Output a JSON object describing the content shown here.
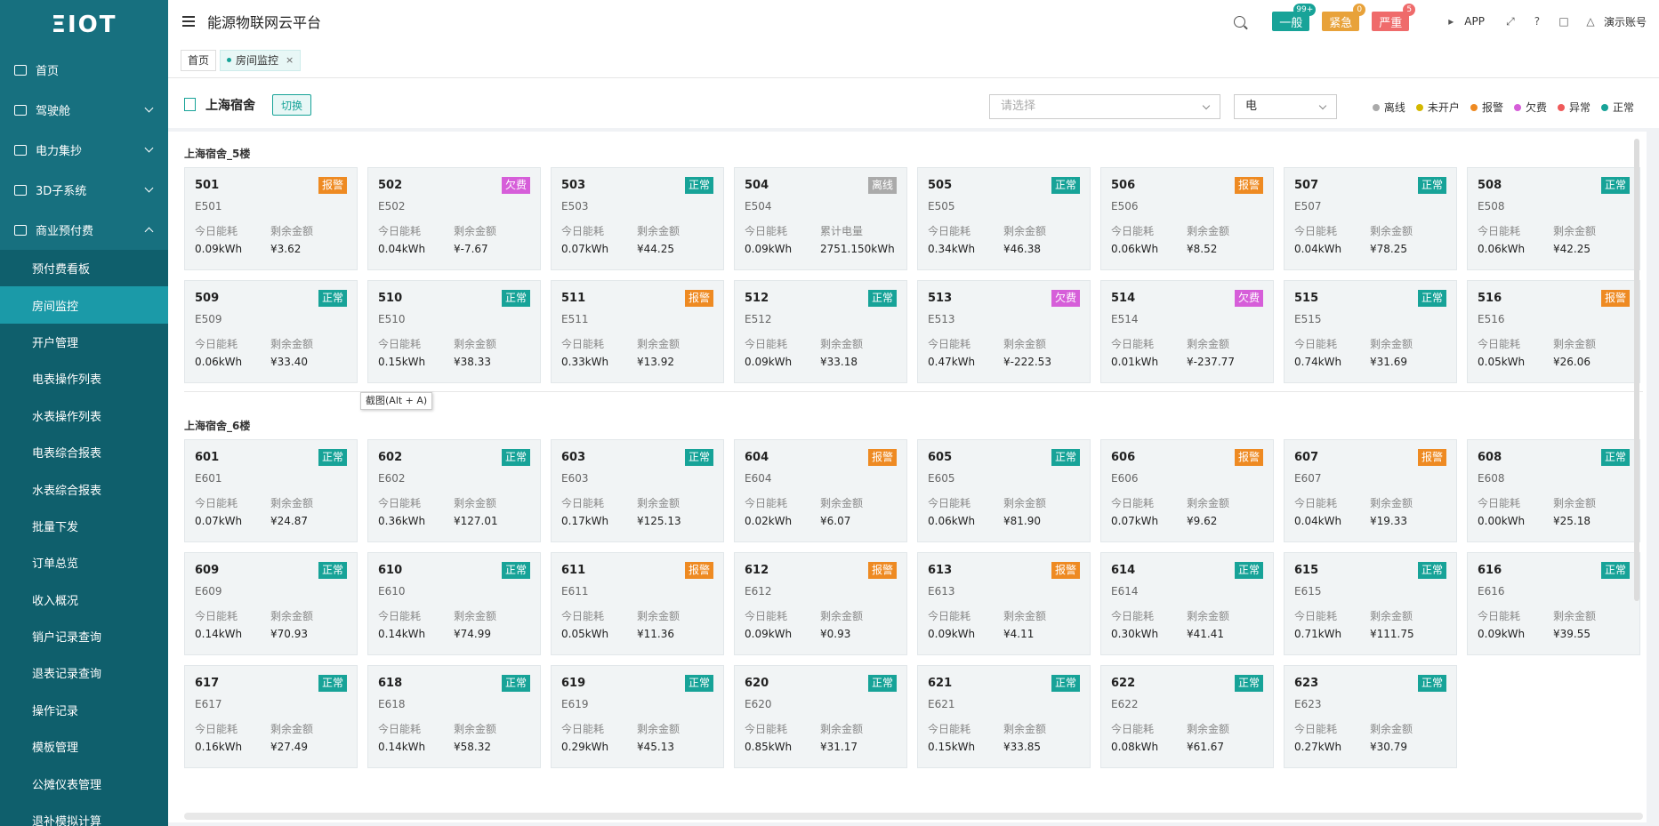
{
  "sidebar": {
    "logo": "ΞIOT",
    "menu": [
      {
        "label": "首页",
        "icon": "monitor-icon",
        "expandable": false
      },
      {
        "label": "驾驶舱",
        "icon": "dashboard-icon",
        "expandable": true
      },
      {
        "label": "电力集抄",
        "icon": "meter-icon",
        "expandable": true
      },
      {
        "label": "3D子系统",
        "icon": "building-icon",
        "expandable": true
      },
      {
        "label": "商业预付费",
        "icon": "user-icon",
        "expandable": true,
        "expanded": true
      }
    ],
    "submenu": [
      {
        "label": "预付费看板"
      },
      {
        "label": "房间监控",
        "active": true
      },
      {
        "label": "开户管理"
      },
      {
        "label": "电表操作列表"
      },
      {
        "label": "水表操作列表"
      },
      {
        "label": "电表综合报表"
      },
      {
        "label": "水表综合报表"
      },
      {
        "label": "批量下发"
      },
      {
        "label": "订单总览"
      },
      {
        "label": "收入概况"
      },
      {
        "label": "销户记录查询"
      },
      {
        "label": "退表记录查询"
      },
      {
        "label": "操作记录"
      },
      {
        "label": "模板管理"
      },
      {
        "label": "公摊仪表管理"
      },
      {
        "label": "退补模拟计算"
      }
    ]
  },
  "header": {
    "title": "能源物联网云平台",
    "alerts": [
      {
        "label": "一般",
        "count": "99+",
        "color": "#17a398",
        "count_color": "#17a398"
      },
      {
        "label": "紧急",
        "count": "0",
        "color": "#e8a23a",
        "count_color": "#e8a23a"
      },
      {
        "label": "严重",
        "count": "5",
        "color": "#ef6b6b",
        "count_color": "#ef6b6b"
      }
    ],
    "app_label": "APP",
    "account_label": "演示账号"
  },
  "tabs": [
    {
      "label": "首页",
      "active": false
    },
    {
      "label": "房间监控",
      "active": true,
      "close": "×"
    }
  ],
  "toolbar": {
    "building": "上海宿舍",
    "switch_label": "切换",
    "select_placeholder": "请选择",
    "meter_type": "电"
  },
  "legend": [
    {
      "label": "离线",
      "color": "#aaaaaa"
    },
    {
      "label": "未开户",
      "color": "#d4b800"
    },
    {
      "label": "报警",
      "color": "#ee8a22"
    },
    {
      "label": "欠费",
      "color": "#d65ed9"
    },
    {
      "label": "异常",
      "color": "#ef5a5a"
    },
    {
      "label": "正常",
      "color": "#17a398"
    }
  ],
  "status_colors": {
    "正常": "#17a398",
    "报警": "#ee8a22",
    "欠费": "#d65ed9",
    "离线": "#aaaaaa"
  },
  "tooltip": "截图(Alt + A)",
  "floors": [
    {
      "title": "上海宿舍_5楼",
      "rooms": [
        {
          "num": "501",
          "code": "E501",
          "status": "报警",
          "l1": "今日能耗",
          "v1": "0.09kWh",
          "l2": "剩余金额",
          "v2": "¥3.62"
        },
        {
          "num": "502",
          "code": "E502",
          "status": "欠费",
          "l1": "今日能耗",
          "v1": "0.04kWh",
          "l2": "剩余金额",
          "v2": "¥-7.67"
        },
        {
          "num": "503",
          "code": "E503",
          "status": "正常",
          "l1": "今日能耗",
          "v1": "0.07kWh",
          "l2": "剩余金额",
          "v2": "¥44.25"
        },
        {
          "num": "504",
          "code": "E504",
          "status": "离线",
          "l1": "今日能耗",
          "v1": "0.09kWh",
          "l2": "累计电量",
          "v2": "2751.150kWh"
        },
        {
          "num": "505",
          "code": "E505",
          "status": "正常",
          "l1": "今日能耗",
          "v1": "0.34kWh",
          "l2": "剩余金额",
          "v2": "¥46.38"
        },
        {
          "num": "506",
          "code": "E506",
          "status": "报警",
          "l1": "今日能耗",
          "v1": "0.06kWh",
          "l2": "剩余金额",
          "v2": "¥8.52"
        },
        {
          "num": "507",
          "code": "E507",
          "status": "正常",
          "l1": "今日能耗",
          "v1": "0.04kWh",
          "l2": "剩余金额",
          "v2": "¥78.25"
        },
        {
          "num": "508",
          "code": "E508",
          "status": "正常",
          "l1": "今日能耗",
          "v1": "0.06kWh",
          "l2": "剩余金额",
          "v2": "¥42.25"
        },
        {
          "num": "509",
          "code": "E509",
          "status": "正常",
          "l1": "今日能耗",
          "v1": "0.06kWh",
          "l2": "剩余金额",
          "v2": "¥33.40"
        },
        {
          "num": "510",
          "code": "E510",
          "status": "正常",
          "l1": "今日能耗",
          "v1": "0.15kWh",
          "l2": "剩余金额",
          "v2": "¥38.33"
        },
        {
          "num": "511",
          "code": "E511",
          "status": "报警",
          "l1": "今日能耗",
          "v1": "0.33kWh",
          "l2": "剩余金额",
          "v2": "¥13.92"
        },
        {
          "num": "512",
          "code": "E512",
          "status": "正常",
          "l1": "今日能耗",
          "v1": "0.09kWh",
          "l2": "剩余金额",
          "v2": "¥33.18"
        },
        {
          "num": "513",
          "code": "E513",
          "status": "欠费",
          "l1": "今日能耗",
          "v1": "0.47kWh",
          "l2": "剩余金额",
          "v2": "¥-222.53"
        },
        {
          "num": "514",
          "code": "E514",
          "status": "欠费",
          "l1": "今日能耗",
          "v1": "0.01kWh",
          "l2": "剩余金额",
          "v2": "¥-237.77"
        },
        {
          "num": "515",
          "code": "E515",
          "status": "正常",
          "l1": "今日能耗",
          "v1": "0.74kWh",
          "l2": "剩余金额",
          "v2": "¥31.69"
        },
        {
          "num": "516",
          "code": "E516",
          "status": "报警",
          "l1": "今日能耗",
          "v1": "0.05kWh",
          "l2": "剩余金额",
          "v2": "¥26.06"
        }
      ]
    },
    {
      "title": "上海宿舍_6楼",
      "rooms": [
        {
          "num": "601",
          "code": "E601",
          "status": "正常",
          "l1": "今日能耗",
          "v1": "0.07kWh",
          "l2": "剩余金额",
          "v2": "¥24.87"
        },
        {
          "num": "602",
          "code": "E602",
          "status": "正常",
          "l1": "今日能耗",
          "v1": "0.36kWh",
          "l2": "剩余金额",
          "v2": "¥127.01"
        },
        {
          "num": "603",
          "code": "E603",
          "status": "正常",
          "l1": "今日能耗",
          "v1": "0.17kWh",
          "l2": "剩余金额",
          "v2": "¥125.13"
        },
        {
          "num": "604",
          "code": "E604",
          "status": "报警",
          "l1": "今日能耗",
          "v1": "0.02kWh",
          "l2": "剩余金额",
          "v2": "¥6.07"
        },
        {
          "num": "605",
          "code": "E605",
          "status": "正常",
          "l1": "今日能耗",
          "v1": "0.06kWh",
          "l2": "剩余金额",
          "v2": "¥81.90"
        },
        {
          "num": "606",
          "code": "E606",
          "status": "报警",
          "l1": "今日能耗",
          "v1": "0.07kWh",
          "l2": "剩余金额",
          "v2": "¥9.62"
        },
        {
          "num": "607",
          "code": "E607",
          "status": "报警",
          "l1": "今日能耗",
          "v1": "0.04kWh",
          "l2": "剩余金额",
          "v2": "¥19.33"
        },
        {
          "num": "608",
          "code": "E608",
          "status": "正常",
          "l1": "今日能耗",
          "v1": "0.00kWh",
          "l2": "剩余金额",
          "v2": "¥25.18"
        },
        {
          "num": "609",
          "code": "E609",
          "status": "正常",
          "l1": "今日能耗",
          "v1": "0.14kWh",
          "l2": "剩余金额",
          "v2": "¥70.93"
        },
        {
          "num": "610",
          "code": "E610",
          "status": "正常",
          "l1": "今日能耗",
          "v1": "0.14kWh",
          "l2": "剩余金额",
          "v2": "¥74.99"
        },
        {
          "num": "611",
          "code": "E611",
          "status": "报警",
          "l1": "今日能耗",
          "v1": "0.05kWh",
          "l2": "剩余金额",
          "v2": "¥11.36"
        },
        {
          "num": "612",
          "code": "E612",
          "status": "报警",
          "l1": "今日能耗",
          "v1": "0.09kWh",
          "l2": "剩余金额",
          "v2": "¥0.93"
        },
        {
          "num": "613",
          "code": "E613",
          "status": "报警",
          "l1": "今日能耗",
          "v1": "0.09kWh",
          "l2": "剩余金额",
          "v2": "¥4.11"
        },
        {
          "num": "614",
          "code": "E614",
          "status": "正常",
          "l1": "今日能耗",
          "v1": "0.30kWh",
          "l2": "剩余金额",
          "v2": "¥41.41"
        },
        {
          "num": "615",
          "code": "E615",
          "status": "正常",
          "l1": "今日能耗",
          "v1": "0.71kWh",
          "l2": "剩余金额",
          "v2": "¥111.75"
        },
        {
          "num": "616",
          "code": "E616",
          "status": "正常",
          "l1": "今日能耗",
          "v1": "0.09kWh",
          "l2": "剩余金额",
          "v2": "¥39.55"
        },
        {
          "num": "617",
          "code": "E617",
          "status": "正常",
          "l1": "今日能耗",
          "v1": "0.16kWh",
          "l2": "剩余金额",
          "v2": "¥27.49"
        },
        {
          "num": "618",
          "code": "E618",
          "status": "正常",
          "l1": "今日能耗",
          "v1": "0.14kWh",
          "l2": "剩余金额",
          "v2": "¥58.32"
        },
        {
          "num": "619",
          "code": "E619",
          "status": "正常",
          "l1": "今日能耗",
          "v1": "0.29kWh",
          "l2": "剩余金额",
          "v2": "¥45.13"
        },
        {
          "num": "620",
          "code": "E620",
          "status": "正常",
          "l1": "今日能耗",
          "v1": "0.85kWh",
          "l2": "剩余金额",
          "v2": "¥31.17"
        },
        {
          "num": "621",
          "code": "E621",
          "status": "正常",
          "l1": "今日能耗",
          "v1": "0.15kWh",
          "l2": "剩余金额",
          "v2": "¥33.85"
        },
        {
          "num": "622",
          "code": "E622",
          "status": "正常",
          "l1": "今日能耗",
          "v1": "0.08kWh",
          "l2": "剩余金额",
          "v2": "¥61.67"
        },
        {
          "num": "623",
          "code": "E623",
          "status": "正常",
          "l1": "今日能耗",
          "v1": "0.27kWh",
          "l2": "剩余金额",
          "v2": "¥30.79"
        }
      ]
    }
  ]
}
